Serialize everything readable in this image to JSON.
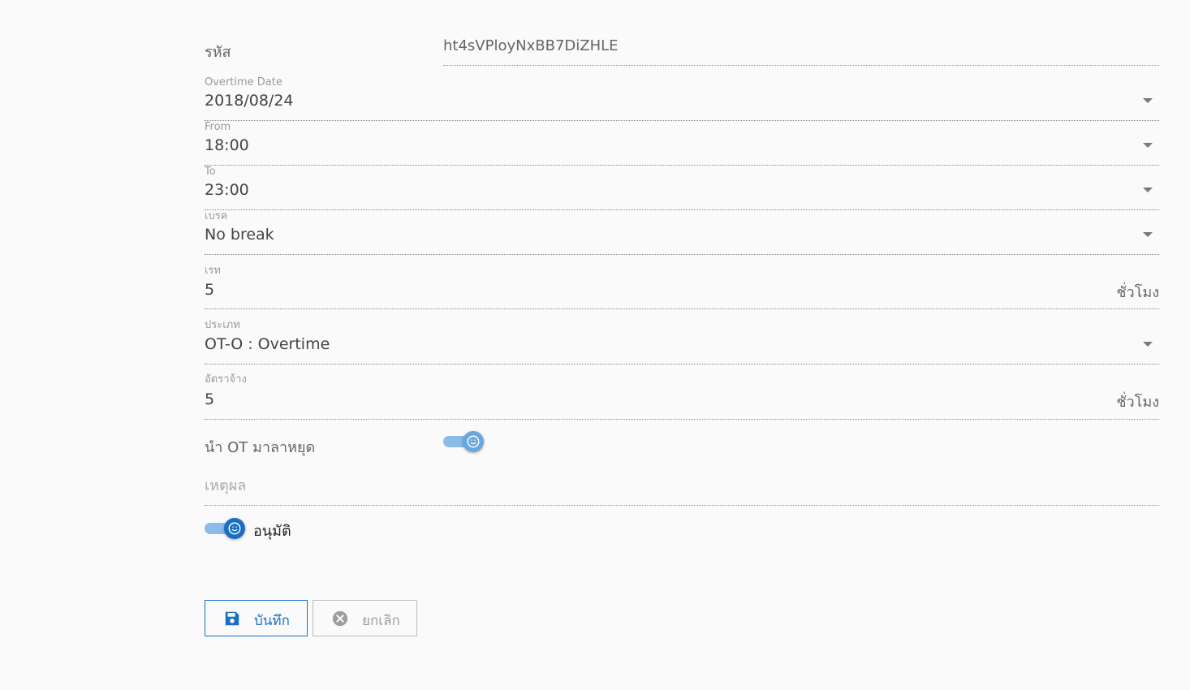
{
  "code": {
    "label": "รหัส",
    "value": "ht4sVPloyNxBB7DiZHLE"
  },
  "overtime_date": {
    "label": "Overtime Date",
    "value": "2018/08/24"
  },
  "from": {
    "label": "From",
    "value": "18:00"
  },
  "to": {
    "label": "To",
    "value": "23:00"
  },
  "break": {
    "label": "เบรค",
    "value": "No break"
  },
  "rate": {
    "label": "เรท",
    "value": "5",
    "suffix": "ชั่วโมง"
  },
  "type": {
    "label": "ประเภท",
    "value": "OT-O : Overtime"
  },
  "wage": {
    "label": "อัตราจ้าง",
    "value": "5",
    "suffix": "ชั่วโมง"
  },
  "ot_to_leave": {
    "label": "นำ OT มาลาหยุด",
    "checked": true
  },
  "reason": {
    "placeholder": "เหตุผล"
  },
  "approve": {
    "label": "อนุมัติ",
    "checked": true
  },
  "buttons": {
    "save": "บันทึก",
    "cancel": "ยกเลิก"
  },
  "colors": {
    "primary": "#1a6fc4",
    "toggle_track": "#8cbbe8",
    "cancel": "#9e9e9e"
  },
  "icons": {
    "save": "floppy-disk-icon",
    "cancel": "close-circle-icon",
    "dropdown": "caret-down-icon",
    "toggle_thumb": "smiley-icon"
  }
}
